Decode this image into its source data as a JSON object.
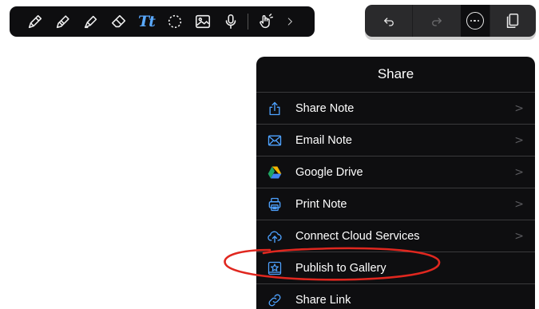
{
  "toolbar": {
    "tools": [
      {
        "name": "pen-icon"
      },
      {
        "name": "pencil-icon"
      },
      {
        "name": "highlighter-icon"
      },
      {
        "name": "eraser-icon"
      },
      {
        "name": "text-tool-icon",
        "label": "Tt"
      },
      {
        "name": "lasso-icon"
      },
      {
        "name": "image-icon"
      },
      {
        "name": "microphone-icon"
      },
      {
        "name": "pointer-hand-icon"
      },
      {
        "name": "chevron-right-icon",
        "label": ">"
      }
    ]
  },
  "history": {
    "undo_icon": "undo-icon",
    "redo_icon": "redo-icon",
    "more_icon": "more-ellipsis-icon",
    "pages_icon": "pages-icon"
  },
  "share_menu": {
    "title": "Share",
    "items": [
      {
        "label": "Share Note",
        "icon": "share-upload-icon",
        "chevron": ">"
      },
      {
        "label": "Email Note",
        "icon": "envelope-icon",
        "chevron": ">"
      },
      {
        "label": "Google Drive",
        "icon": "google-drive-icon",
        "chevron": ">"
      },
      {
        "label": "Print Note",
        "icon": "printer-icon",
        "chevron": ">"
      },
      {
        "label": "Connect Cloud Services",
        "icon": "cloud-upload-icon",
        "chevron": ">"
      },
      {
        "label": "Publish to Gallery",
        "icon": "gallery-star-icon",
        "chevron": ""
      },
      {
        "label": "Share Link",
        "icon": "link-icon",
        "chevron": ""
      }
    ]
  },
  "colors": {
    "accent": "#4ea2ff",
    "annotation": "#e0271f",
    "panel": "#0e0e10"
  }
}
